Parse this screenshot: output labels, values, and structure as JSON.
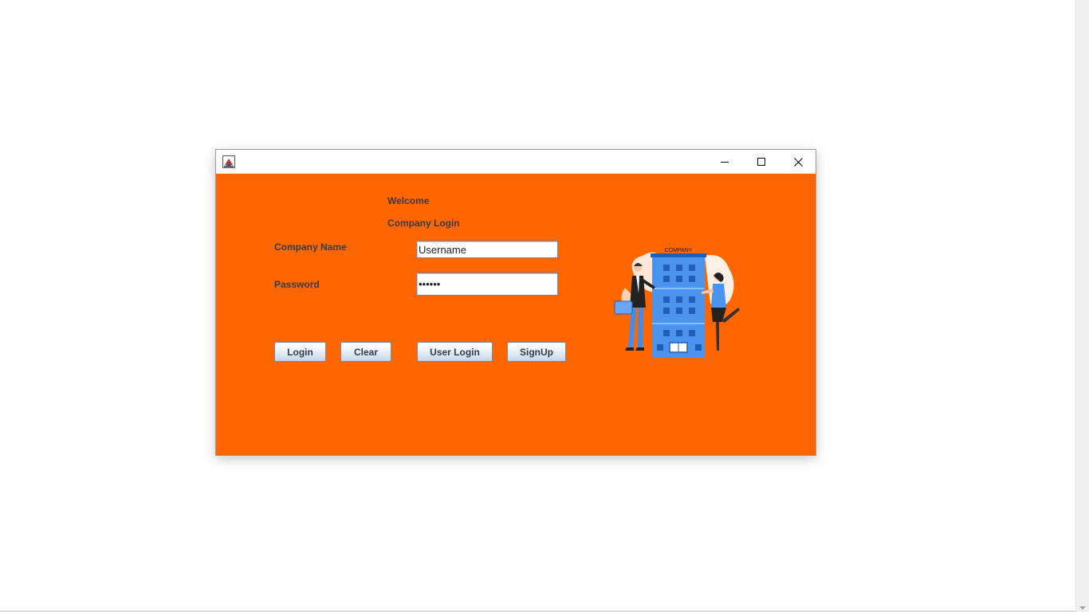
{
  "window": {
    "title": "",
    "controls": {
      "minimize_icon": "minimize-icon",
      "maximize_icon": "maximize-icon",
      "close_icon": "close-icon"
    }
  },
  "form": {
    "welcome": "Welcome",
    "heading": "Company Login",
    "company_name_label": "Company Name",
    "password_label": "Password",
    "username_value": "Username",
    "password_value": "••••••"
  },
  "buttons": {
    "login": "Login",
    "clear": "Clear",
    "user_login": "User Login",
    "signup": "SignUp"
  },
  "illustration": {
    "sign_text": "COMPANY"
  },
  "colors": {
    "background": "#ff6600",
    "label_text": "#333d4a",
    "building": "#3d8ef0"
  }
}
